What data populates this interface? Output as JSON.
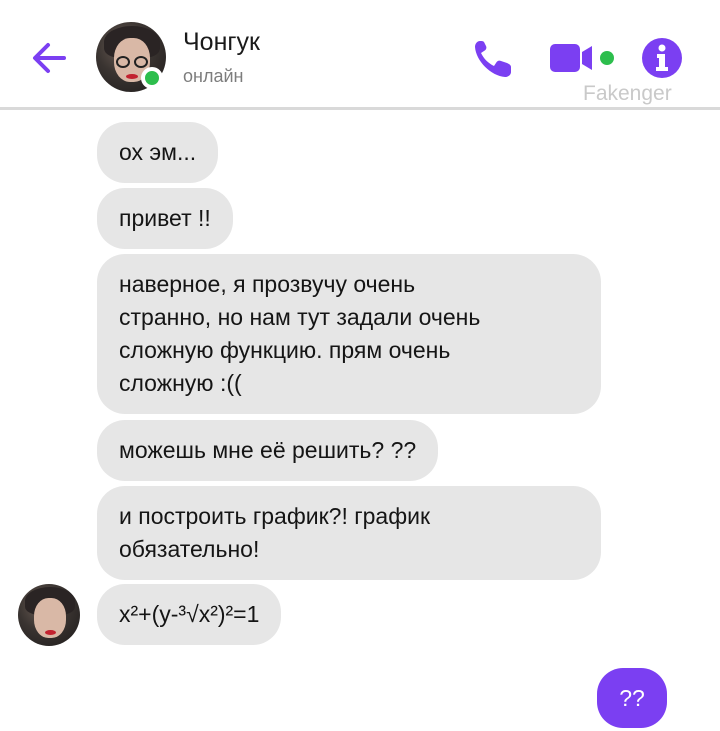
{
  "header": {
    "contact_name": "Чонгук",
    "status": "онлайн",
    "watermark": "Fakenger",
    "icons": {
      "back": "back-arrow-icon",
      "call": "phone-icon",
      "video": "video-camera-icon",
      "info": "info-icon"
    }
  },
  "colors": {
    "accent": "#7b3ff2",
    "online": "#2dbe4d",
    "received_bubble": "#e6e6e6"
  },
  "messages": [
    {
      "text": "ох эм..."
    },
    {
      "text": "привет !!"
    },
    {
      "text": "наверное, я прозвучу очень\nстранно, но нам тут задали очень\nсложную функцию. прям очень\nсложную :(("
    },
    {
      "text": "можешь мне её решить? ??"
    },
    {
      "text": "и построить график?! график\nобязательно!"
    },
    {
      "text": "x²+(y-³√x²)²=1"
    }
  ],
  "sent_messages": [
    {
      "text": "??"
    }
  ]
}
